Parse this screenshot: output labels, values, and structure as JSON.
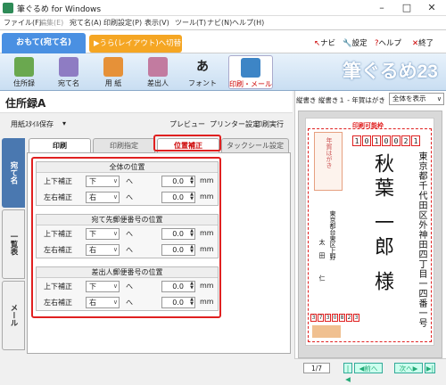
{
  "window": {
    "title": "筆ぐるめ for Windows",
    "min": "–",
    "max": "□",
    "close": "✕"
  },
  "menu": [
    "ファイル(F)",
    "編集(E)",
    "宛て名(A)",
    "印刷設定(P)",
    "表示(V)",
    "ツール(T)",
    "ナビ(N)",
    "ヘルプ(H)"
  ],
  "mode": {
    "front": "おもて(宛て名)",
    "back": "▶うら(レイアウト)へ切替"
  },
  "topbtns": {
    "navi": "ナビ",
    "settings": "設定",
    "help": "ヘルプ",
    "exit": "終了"
  },
  "ribbon": [
    {
      "label": "住所録",
      "color": "#6aa84f"
    },
    {
      "label": "宛て名",
      "color": "#8e7cc3"
    },
    {
      "label": "用 紙",
      "color": "#e69138"
    },
    {
      "label": "差出人",
      "color": "#c27ba0"
    },
    {
      "label": "フォント",
      "color": "#333333"
    },
    {
      "label": "印刷・メール",
      "color": "#3d85c6"
    }
  ],
  "brand": "筆ぐるめ23",
  "doc": {
    "title": "住所録A"
  },
  "toolbar": {
    "save": "用紙ｽﾀｲﾙ保存",
    "dropdown": "▾",
    "preview": "プレビュー",
    "printer": "プリンター設定",
    "exec": "印刷実行"
  },
  "sidetabs": [
    "宛て名",
    "一覧表",
    "メール"
  ],
  "subtabs": [
    "印刷",
    "印刷指定",
    "位置補正",
    "タックシール設定"
  ],
  "groups": [
    {
      "title": "全体の位置",
      "rows": [
        {
          "label": "上下補正",
          "dir": "下",
          "value": "0.0"
        },
        {
          "label": "左右補正",
          "dir": "右",
          "value": "0.0"
        }
      ]
    },
    {
      "title": "宛て先郵便番号の位置",
      "rows": [
        {
          "label": "上下補正",
          "dir": "下",
          "value": "0.0"
        },
        {
          "label": "左右補正",
          "dir": "右",
          "value": "0.0"
        }
      ]
    },
    {
      "title": "差出人郵便番号の位置",
      "rows": [
        {
          "label": "上下補正",
          "dir": "下",
          "value": "0.0"
        },
        {
          "label": "左右補正",
          "dir": "右",
          "value": "0.0"
        }
      ]
    }
  ],
  "common": {
    "arrow": "へ",
    "unit": "mm",
    "chev": "∨"
  },
  "preview": {
    "info": "縦書き 縦書き１ - 年賀はがき",
    "zoom": "全体を表示",
    "printable": "印刷可能枠",
    "zip": [
      "1",
      "0",
      "1",
      "0",
      "0",
      "2",
      "1"
    ],
    "address": "東京都千代田区外神田四丁目一四番一号",
    "name": "秋葉 一郎 様",
    "sender_addr": "東京都台東区上野",
    "sender_name": "太田 仁",
    "sender_zip": [
      "3",
      "7",
      "3",
      "0",
      "8",
      "2",
      "3"
    ],
    "stamp": "年賀はがき",
    "page": "1/7",
    "prev": "前へ",
    "next": "次へ"
  }
}
